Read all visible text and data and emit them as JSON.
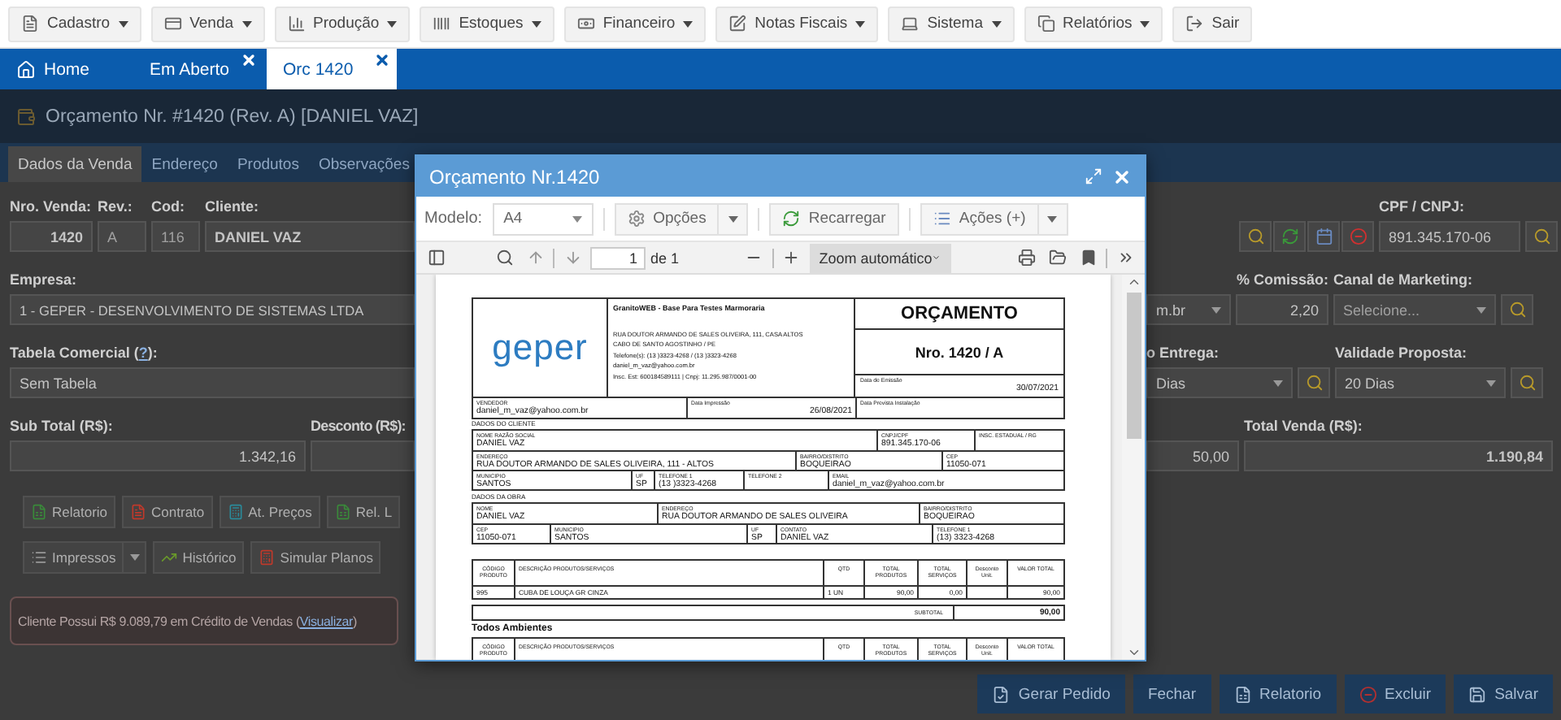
{
  "menu": [
    {
      "label": "Cadastro",
      "caret": true
    },
    {
      "label": "Venda",
      "caret": true
    },
    {
      "label": "Produção",
      "caret": true
    },
    {
      "label": "Estoques",
      "caret": true
    },
    {
      "label": "Financeiro",
      "caret": true
    },
    {
      "label": "Notas Fiscais",
      "caret": true
    },
    {
      "label": "Sistema",
      "caret": true
    },
    {
      "label": "Relatórios",
      "caret": true
    },
    {
      "label": "Sair",
      "caret": false
    }
  ],
  "tabs": [
    {
      "label": "Home",
      "selected": false,
      "closable": false
    },
    {
      "label": "Em Aberto",
      "selected": false,
      "closable": true
    },
    {
      "label": "Orc 1420",
      "selected": true,
      "closable": true
    }
  ],
  "page_title": "Orçamento Nr. #1420 (Rev. A) [DANIEL VAZ]",
  "form_tabs": [
    {
      "label": "Dados da Venda",
      "selected": true
    },
    {
      "label": "Endereço",
      "selected": false
    },
    {
      "label": "Produtos",
      "selected": false
    },
    {
      "label": "Observações",
      "selected": false
    }
  ],
  "form": {
    "sale_no": {
      "label": "Nro. Venda:",
      "value": "1420"
    },
    "revision": {
      "label": "Rev.:",
      "value": "A",
      "disabled": true
    },
    "code": {
      "label": "Cod:",
      "value": "116",
      "disabled": true
    },
    "client": {
      "label": "Cliente:",
      "value": "DANIEL VAZ"
    },
    "company": {
      "label": "Empresa:",
      "value": "1 - GEPER - DESENVOLVIMENTO DE SISTEMAS LTDA"
    },
    "price_table": {
      "label_before": "Tabela Comercial (",
      "help_link": "?",
      "label_after": "):",
      "value": "Sem Tabela"
    },
    "subtotal": {
      "label": "Sub Total (R$):",
      "value": "1.342,16"
    },
    "discount": {
      "label": "Desconto (R$):"
    },
    "cpf": {
      "label": "CPF / CNPJ:",
      "value": "891.345.170-06"
    },
    "email_select": {
      "value": "m.br"
    },
    "commission": {
      "label": "% Comissão:",
      "value": "2,20"
    },
    "marketing": {
      "label": "Canal de Marketing:",
      "placeholder": "Selecione..."
    },
    "delivery": {
      "label": "o Entrega:",
      "value": "Dias"
    },
    "validity": {
      "label": "Validade Proposta:",
      "value": "20 Dias"
    },
    "partly_hidden_field": {
      "value": "50,00"
    },
    "total": {
      "label": "Total Venda (R$):",
      "value": "1.190,84"
    }
  },
  "action_buttons": [
    {
      "label": "Relatorio"
    },
    {
      "label": "Contrato"
    },
    {
      "label": "At. Preços"
    },
    {
      "label": "Rel. L"
    }
  ],
  "action_buttons_2": [
    {
      "label": "Impressos",
      "kind": "split"
    },
    {
      "label": "Histórico",
      "kind": "plain"
    },
    {
      "label": "Simular Planos",
      "kind": "plain"
    }
  ],
  "credit_alert": {
    "text_before": "Cliente Possui R$ 9.089,79 em Crédito de Vendas (",
    "link": "Visualizar",
    "text_after": ")"
  },
  "bottom_buttons": [
    {
      "label": "Gerar Pedido"
    },
    {
      "label": "Fechar"
    },
    {
      "label": "Relatorio"
    },
    {
      "label": "Excluir"
    },
    {
      "label": "Salvar"
    }
  ],
  "modal": {
    "title": "Orçamento Nr.1420",
    "model_label": "Modelo:",
    "model_value": "A4",
    "options_label": "Opções",
    "reload_label": "Recarregar",
    "actions_label": "Ações (+)",
    "page_value": "1",
    "page_count": "de 1",
    "zoom": "Zoom automático",
    "document": {
      "logo": "geper",
      "company_name": "GranitoWEB - Base Para Testes Marmoraria",
      "company_lines": [
        "RUA DOUTOR ARMANDO DE SALES OLIVEIRA, 111, CASA ALTOS",
        "CABO DE SANTO AGOSTINHO / PE",
        "Telefone(s): (13 )3323-4268 / (13 )3323-4268",
        "daniel_m_vaz@yahoo.com.br",
        "Insc. Est: 600184589111 | Cnpj: 11.295.987/0001-00"
      ],
      "title": "ORÇAMENTO",
      "number": "Nro. 1420 / A",
      "issue_date": {
        "label": "Data de Emissão",
        "value": "30/07/2021"
      },
      "info_row": [
        {
          "label": "VENDEDOR",
          "value": "daniel_m_vaz@yahoo.com.br"
        },
        {
          "label": "Data Impressão",
          "value": "26/08/2021"
        },
        {
          "label": "Data Prevista Instalação"
        }
      ],
      "client_label": "DADOS DO CLIENTE",
      "client_rows": [
        [
          {
            "label": "NOME RAZÃO SOCIAL",
            "value": "DANIEL VAZ"
          },
          {
            "label": "CNPJ/CPF",
            "value": "891.345.170-06"
          },
          {
            "label": "INSC. ESTADUAL / RG"
          }
        ],
        [
          {
            "label": "ENDEREÇO",
            "value": "RUA DOUTOR ARMANDO DE SALES OLIVEIRA, 111 - ALTOS"
          },
          {
            "label": "BAIRRO/DISTRITO",
            "value": "BOQUEIRAO"
          },
          {
            "label": "CEP",
            "value": "11050-071"
          }
        ],
        [
          {
            "label": "MUNICIPIO",
            "value": "SANTOS"
          },
          {
            "label": "UF",
            "value": "SP"
          },
          {
            "label": "TELEFONE 1",
            "value": "(13 )3323-4268"
          },
          {
            "label": "TELEFONE 2"
          },
          {
            "label": "EMAIL",
            "value": "daniel_m_vaz@yahoo.com.br"
          }
        ]
      ],
      "site_label": "DADOS DA OBRA",
      "site_rows": [
        [
          {
            "label": "NOME",
            "value": "DANIEL VAZ"
          },
          {
            "label": "ENDEREÇO",
            "value": "RUA DOUTOR ARMANDO DE SALES OLIVEIRA"
          },
          {
            "label": "BAIRRO/DISTRITO",
            "value": "BOQUEIRAO"
          }
        ],
        [
          {
            "label": "CEP",
            "value": "11050-071"
          },
          {
            "label": "MUNICIPIO",
            "value": "SANTOS"
          },
          {
            "label": "UF",
            "value": "SP"
          },
          {
            "label": "CONTATO",
            "value": "DANIEL VAZ"
          },
          {
            "label": "TELEFONE 1",
            "value": "(13) 3323-4268"
          }
        ]
      ],
      "item_columns": [
        "CÓDIGO PRODUTO",
        "DESCRIÇÃO PRODUTOS/SERVIÇOS",
        "QTD",
        "TOTAL PRODUTOS",
        "TOTAL SERVIÇOS",
        "Desconto Unit.",
        "VALOR TOTAL"
      ],
      "items": [
        {
          "code": "995",
          "description": "CUBA DE LOUÇA GR CINZA",
          "qty": "1 UN",
          "total_products": "90,00",
          "total_services": "0,00",
          "total": "90,00"
        }
      ],
      "subtotal": {
        "label": "SUBTOTAL",
        "value": "90,00"
      },
      "group_title": "Todos Ambientes",
      "group_columns": [
        "CÓDIGO PRODUTO",
        "DESCRIÇÃO PRODUTOS/SERVIÇOS",
        "QTD",
        "TOTAL PRODUTOS",
        "TOTAL SERVIÇOS",
        "Desconto Unit.",
        "VALOR TOTAL"
      ]
    }
  }
}
